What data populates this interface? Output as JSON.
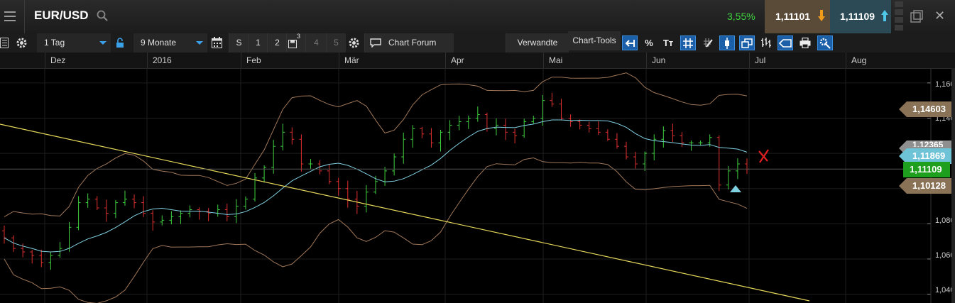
{
  "header": {
    "symbol": "EUR/USD",
    "change": "3,55%",
    "sell_price": "1,11101",
    "buy_price": "1,11109",
    "close_glyph": "✕"
  },
  "toolbar": {
    "interval": "1 Tag",
    "range": "9 Monate",
    "s_label": "S",
    "n1": "1",
    "n2": "2",
    "n3_sup": "3",
    "n4": "4",
    "n5": "5",
    "chart_forum": "Chart Forum",
    "verwandte": "Verwandte",
    "chart_tools": "Chart-Tools",
    "percent": "%",
    "text_tool": "Tт"
  },
  "months": [
    "Dez",
    "2016",
    "Feb",
    "Mär",
    "Apr",
    "Mai",
    "Jun",
    "Jul",
    "Aug"
  ],
  "y_axis": [
    "1,16000",
    "1,14000",
    "1,12000",
    "1,10000",
    "1,08000",
    "1,06000",
    "1,04000"
  ],
  "tags": {
    "upper_band": "1,14603",
    "partial": "1,12365",
    "ma": "1,11869",
    "last": "1,11109",
    "lower_band": "1,10128"
  },
  "colors": {
    "bull": "#3fd13f",
    "bear": "#e03030",
    "bands": "#a0785a",
    "ma": "#7fd0e0",
    "trend": "#e6d85a",
    "tag_band": "#8a7256",
    "tag_ma": "#6fc3d6",
    "tag_last": "#1ea01e"
  },
  "icons": [
    "menu-icon",
    "search-icon",
    "arrow-down-icon",
    "arrow-up-icon",
    "popout-icon",
    "close-icon",
    "list-icon",
    "gear-icon",
    "lock-icon",
    "calendar-icon",
    "save-icon",
    "chat-icon",
    "back-arrow-icon",
    "crosshair-grid-icon",
    "pencil-icon",
    "candlestick-icon",
    "copy-icon",
    "ohlc-icon",
    "tag-icon",
    "print-icon",
    "settings-icon"
  ],
  "chart_data": {
    "type": "ohlc",
    "ylim": [
      1.035,
      1.168
    ],
    "y_ticks": [
      1.16,
      1.14,
      1.12,
      1.1,
      1.08,
      1.06,
      1.04
    ],
    "x_categories": [
      "Dez",
      "2016",
      "Feb",
      "Mär",
      "Apr",
      "Mai",
      "Jun",
      "Jul",
      "Aug"
    ],
    "series": [
      {
        "name": "close",
        "values": [
          1.072,
          1.066,
          1.064,
          1.062,
          1.058,
          1.062,
          1.066,
          1.078,
          1.092,
          1.094,
          1.089,
          1.086,
          1.092,
          1.094,
          1.092,
          1.086,
          1.081,
          1.082,
          1.084,
          1.086,
          1.088,
          1.087,
          1.086,
          1.088,
          1.084,
          1.09,
          1.094,
          1.106,
          1.112,
          1.124,
          1.132,
          1.128,
          1.114,
          1.114,
          1.11,
          1.104,
          1.1,
          1.094,
          1.09,
          1.098,
          1.104,
          1.11,
          1.118,
          1.128,
          1.134,
          1.131,
          1.126,
          1.132,
          1.136,
          1.138,
          1.14,
          1.142,
          1.134,
          1.136,
          1.132,
          1.13,
          1.138,
          1.14,
          1.15,
          1.148,
          1.14,
          1.138,
          1.136,
          1.134,
          1.132,
          1.128,
          1.124,
          1.118,
          1.114,
          1.12,
          1.128,
          1.133,
          1.13,
          1.126,
          1.126,
          1.126,
          1.129,
          1.102,
          1.11,
          1.114,
          1.111
        ]
      }
    ],
    "last": 1.11109,
    "upper_band": 1.14603,
    "lower_band": 1.10128,
    "ma": 1.11869
  }
}
